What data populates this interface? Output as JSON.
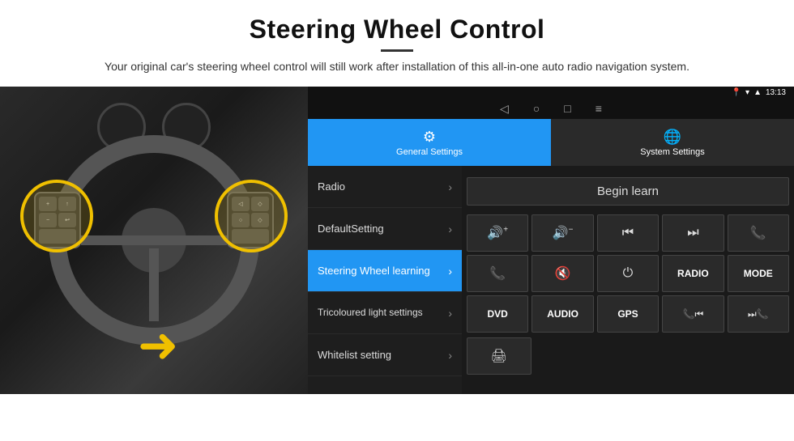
{
  "header": {
    "title": "Steering Wheel Control",
    "subtitle": "Your original car's steering wheel control will still work after installation of this all-in-one auto radio navigation system."
  },
  "status_bar": {
    "time": "13:13",
    "icons": [
      "location",
      "wifi",
      "signal"
    ]
  },
  "tabs": [
    {
      "id": "general",
      "label": "General Settings",
      "active": true
    },
    {
      "id": "system",
      "label": "System Settings",
      "active": false
    }
  ],
  "menu": {
    "items": [
      {
        "label": "Radio",
        "active": false
      },
      {
        "label": "DefaultSetting",
        "active": false
      },
      {
        "label": "Steering Wheel learning",
        "active": true
      },
      {
        "label": "Tricoloured light settings",
        "active": false
      },
      {
        "label": "Whitelist setting",
        "active": false
      }
    ]
  },
  "controls": {
    "begin_learn_label": "Begin learn",
    "buttons_row1": [
      {
        "icon": "🔊+",
        "type": "icon"
      },
      {
        "icon": "🔊−",
        "type": "icon"
      },
      {
        "icon": "⏮",
        "type": "icon"
      },
      {
        "icon": "⏭",
        "type": "icon"
      },
      {
        "icon": "📞",
        "type": "icon"
      }
    ],
    "buttons_row2": [
      {
        "icon": "📞↩",
        "type": "icon"
      },
      {
        "icon": "🔇×",
        "type": "icon"
      },
      {
        "icon": "⏻",
        "type": "icon"
      },
      {
        "label": "RADIO",
        "type": "text"
      },
      {
        "label": "MODE",
        "type": "text"
      }
    ],
    "buttons_row3": [
      {
        "label": "DVD",
        "type": "text"
      },
      {
        "label": "AUDIO",
        "type": "text"
      },
      {
        "label": "GPS",
        "type": "text"
      },
      {
        "icon": "📞⏮",
        "type": "icon"
      },
      {
        "icon": "⏭📞",
        "type": "icon"
      }
    ],
    "bottom_icon": "🖨"
  }
}
